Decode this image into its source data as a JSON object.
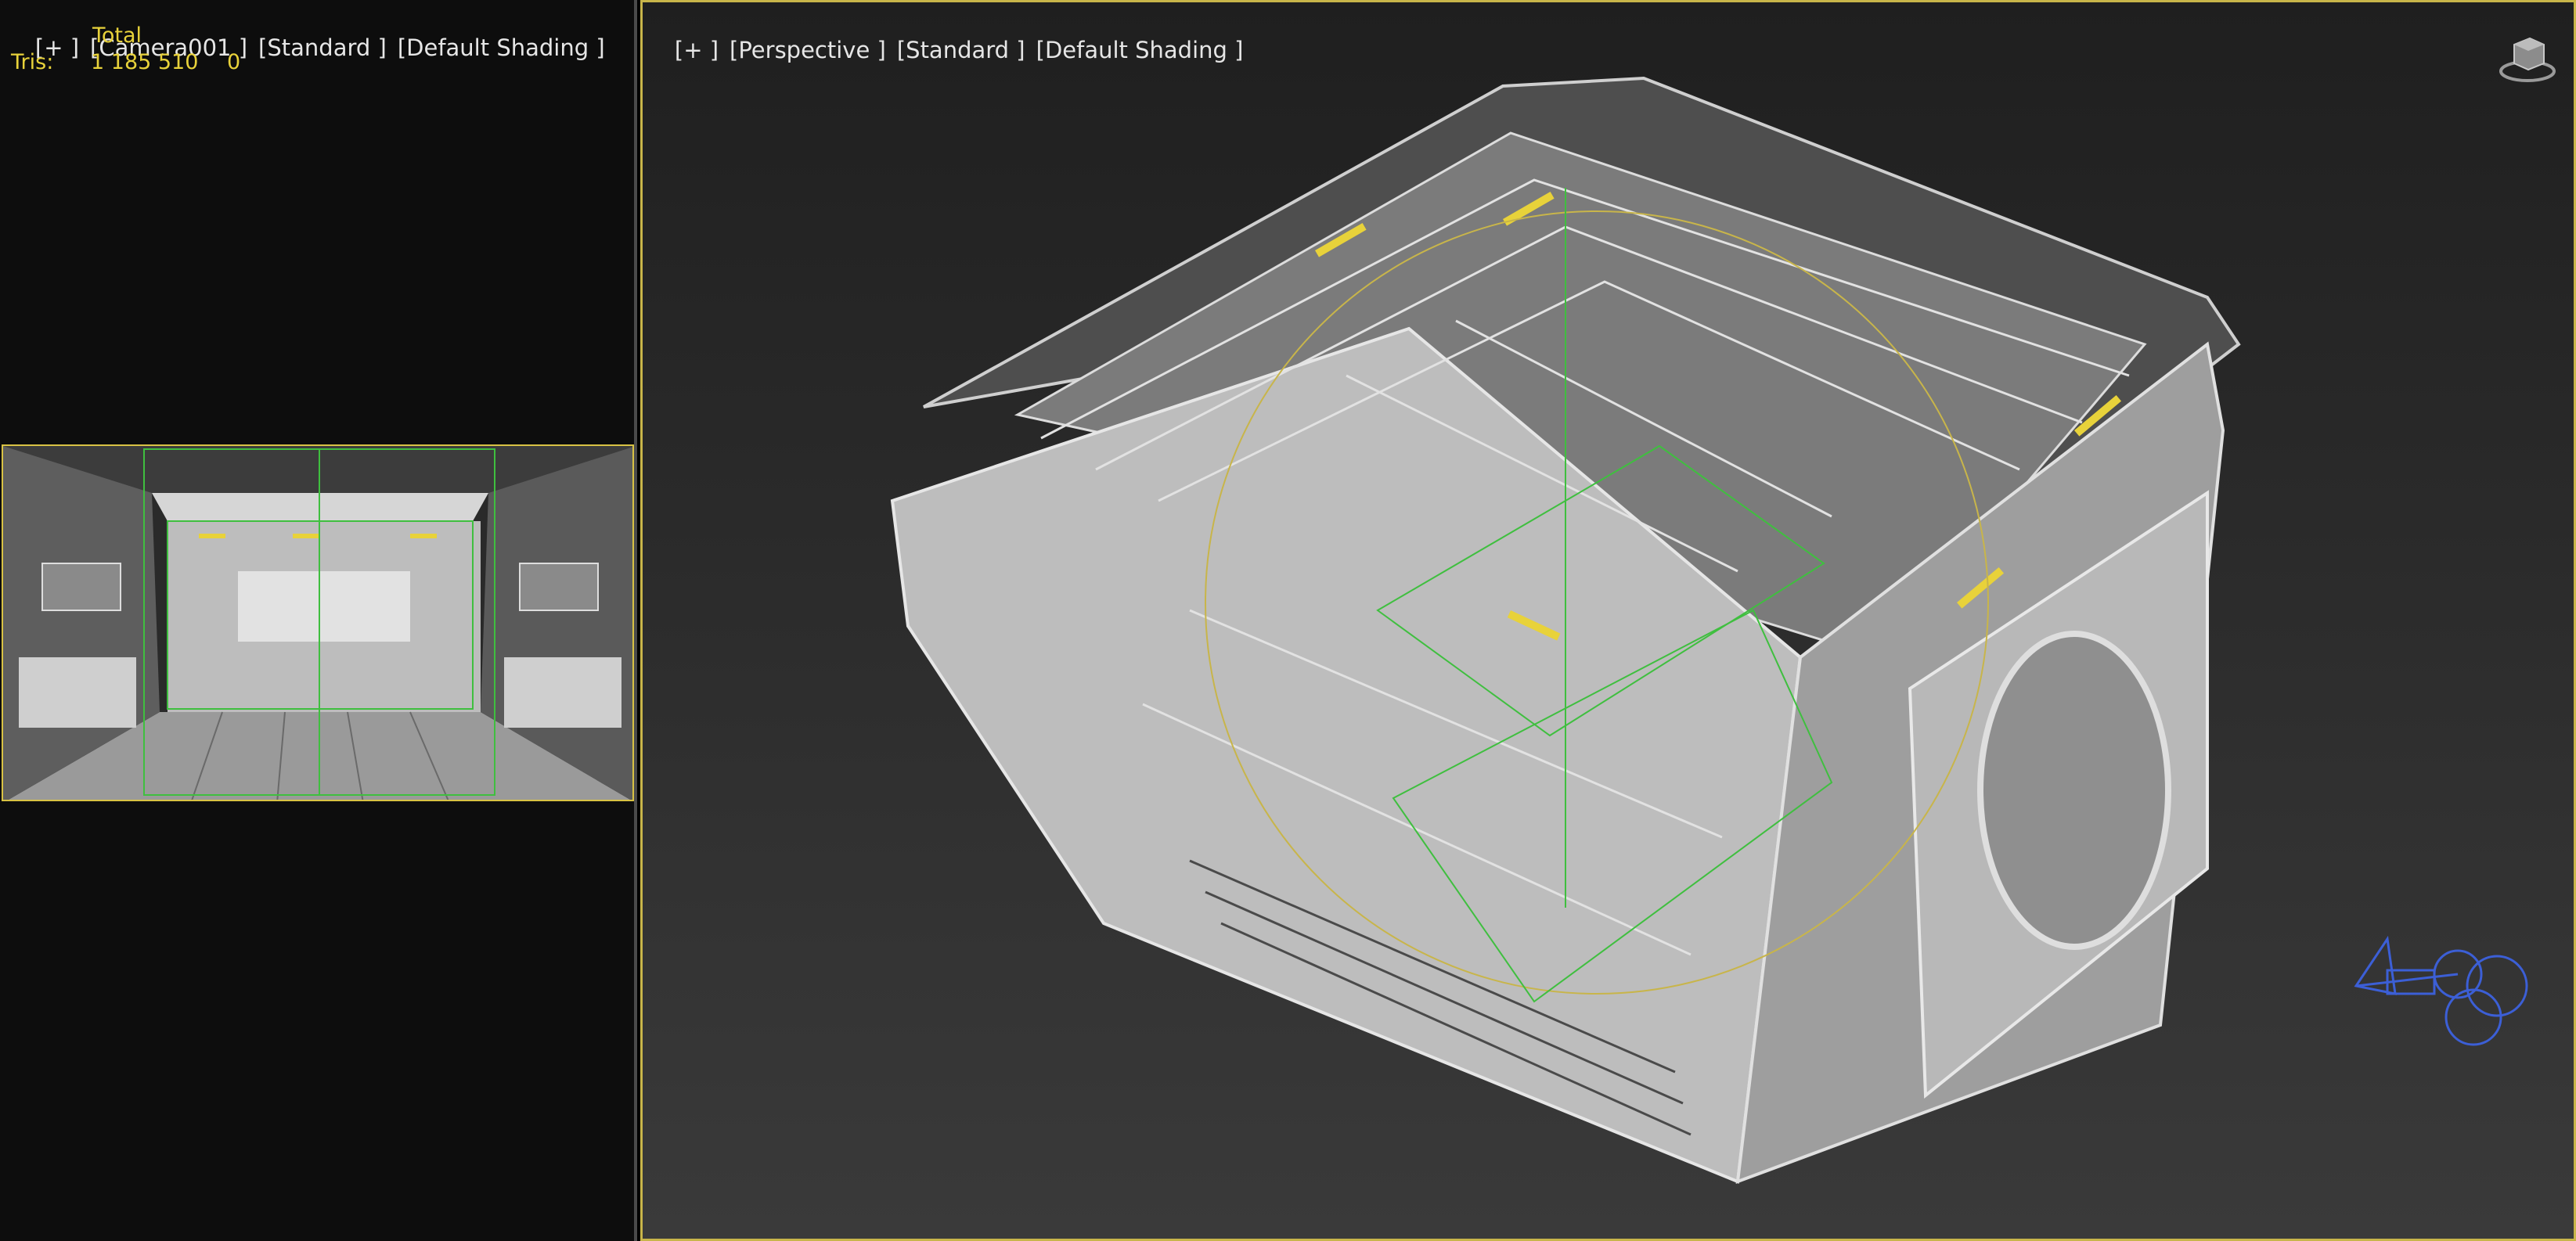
{
  "left_viewport": {
    "labels": [
      "[+ ]",
      "[Camera001 ]",
      "[Standard ]",
      "[Default Shading ]"
    ],
    "stats": {
      "total_label": "Total",
      "tris_label": "Tris:",
      "tris_total": "1 185 510",
      "tris_selected": "0"
    }
  },
  "right_viewport": {
    "labels": [
      "[+ ]",
      "[Perspective ]",
      "[Standard ]",
      "[Default Shading ]"
    ]
  },
  "icons": {
    "viewcube": "viewcube-icon",
    "camera": "camera-gizmo-icon"
  },
  "colors": {
    "stats_text": "#e8d23a",
    "active_border": "#c8b54a",
    "selection_green": "#3fbf3f",
    "camera_blue": "#3c5fd6"
  }
}
